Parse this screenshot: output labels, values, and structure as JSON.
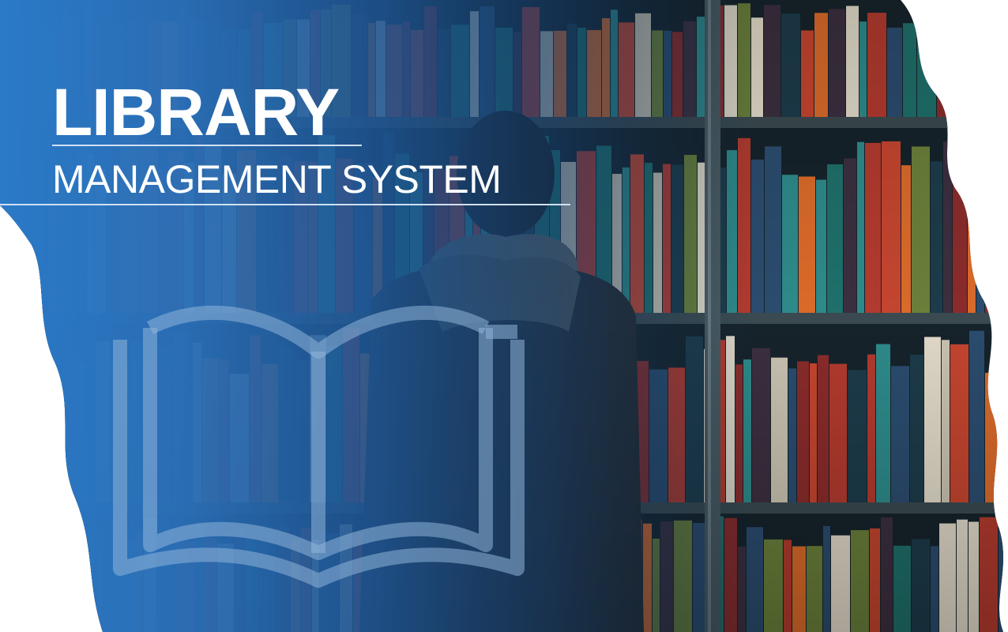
{
  "hero": {
    "title": "LIBRARY",
    "subtitle": "MANAGEMENT SYSTEM"
  },
  "colors": {
    "brand_blue": "#2a7ac8",
    "deep_blue": "#123b6b",
    "shelf_dark": "#1a2a33",
    "white": "#ffffff"
  },
  "icons": {
    "logo": "open-book-icon"
  }
}
